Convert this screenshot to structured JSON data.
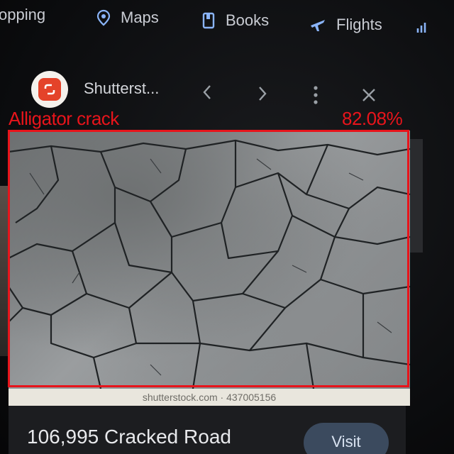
{
  "nav": {
    "tabs": [
      {
        "label": "opping",
        "icon": "shopping-icon"
      },
      {
        "label": "Maps",
        "icon": "map-pin-icon"
      },
      {
        "label": "Books",
        "icon": "book-icon"
      },
      {
        "label": "Flights",
        "icon": "airplane-icon"
      },
      {
        "label": "",
        "icon": "finance-icon"
      }
    ]
  },
  "viewer": {
    "site_name": "Shutterst...",
    "watermark": "shutterstock.com · 437005156",
    "result_title": "106,995 Cracked Road",
    "visit_label": "Visit"
  },
  "detection": {
    "label": "Alligator crack",
    "score": "82.08%",
    "color": "#e8141b"
  },
  "colors": {
    "background": "#0d0e10",
    "logo_red": "#e4432a",
    "nav_blue": "#8ab4f8",
    "visit_bg": "#3b4a5e"
  }
}
